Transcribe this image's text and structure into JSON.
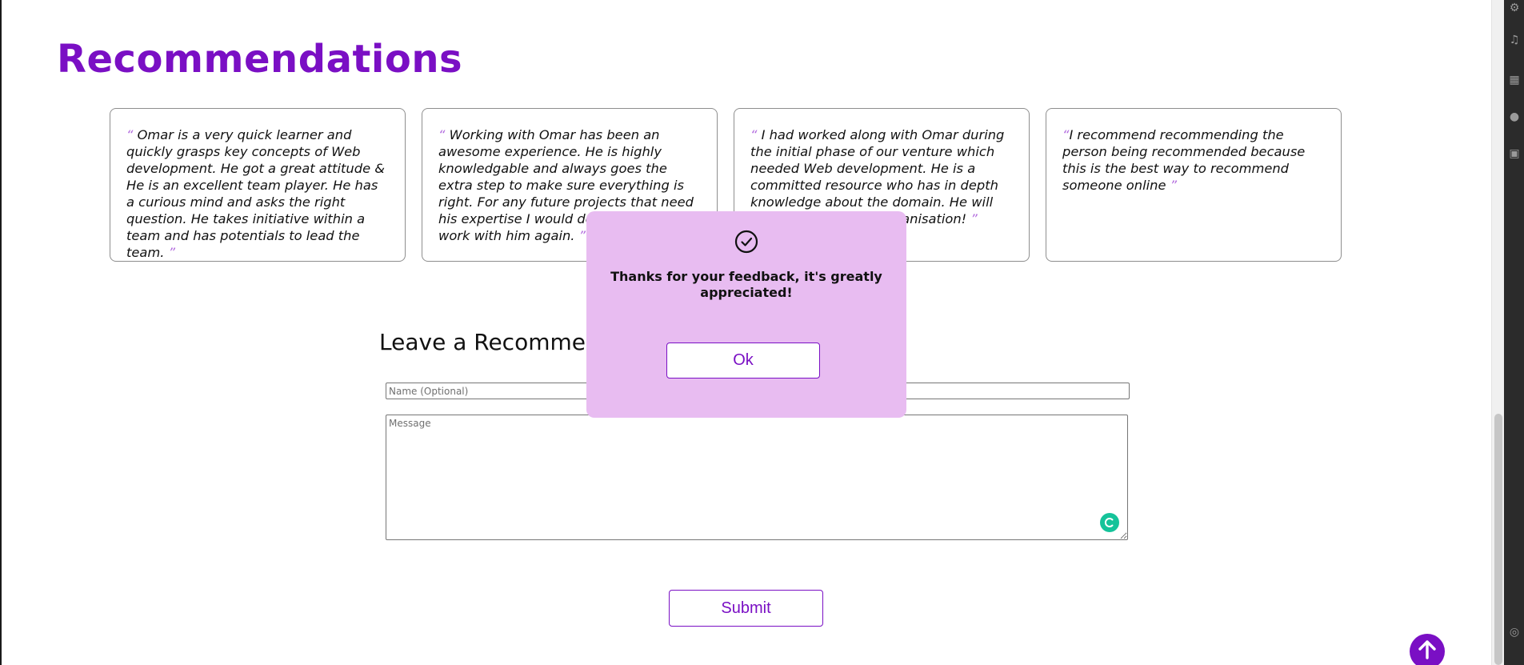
{
  "section": {
    "title": "Recommendations"
  },
  "recommendations": [
    {
      "open": "“",
      "text": " Omar is a very quick learner and quickly grasps key concepts of Web development. He got a great attitude & He is an excellent team player. He has a curious mind and asks the right question. He takes initiative within a team and has potentials to lead the team. ",
      "close": "”"
    },
    {
      "open": "“",
      "text": " Working with Omar has been an awesome experience. He is highly knowledgable and always goes the extra step to make sure everything is right. For any future projects that need his expertise I would definitely love to work with him again. ",
      "close": "”"
    },
    {
      "open": "“",
      "text": " I had worked along with Omar during the initial phase of our venture which needed Web development. He is a committed resource who has in depth knowledge about the domain. He will be an asset for any organisation! ",
      "close": "”"
    },
    {
      "open": "“",
      "text": "I recommend recommending the person being recommended because this is the best way to recommend someone online ",
      "close": "”"
    }
  ],
  "form": {
    "title": "Leave a Recommendation",
    "name_placeholder": "Name (Optional)",
    "message_placeholder": "Message",
    "submit_label": "Submit"
  },
  "modal": {
    "message": "Thanks for your feedback, it's greatly appreciated!",
    "ok_label": "Ok",
    "icon": "check-circle-icon"
  },
  "colors": {
    "accent": "#7a0fc4",
    "modal_bg": "#e8bcf1",
    "quote": "#b26bde",
    "grammar": "#15c39a"
  }
}
